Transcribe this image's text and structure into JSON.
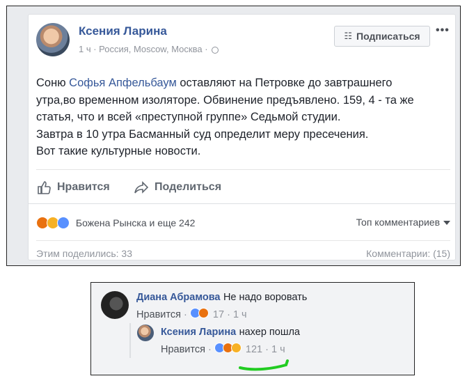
{
  "post": {
    "author": "Ксения Ларина",
    "meta": "1 ч · Россия, Moscow, Москва ·",
    "subscribe_label": "Подписаться",
    "more_label": "•••",
    "text_lines": [
      {
        "before": "Соню ",
        "mention": "Софья Апфельбаум",
        "after": " оставляют на Петровке до завтрашнего"
      },
      {
        "text": "утра,во временном изоляторе. Обвинение предъявлено. 159, 4 - та же"
      },
      {
        "text": "статья, что и всей «преступной группе» Седьмой студии."
      },
      {
        "text": "Завтра в 10 утра Басманный суд определит меру пресечения."
      },
      {
        "text": "Вот такие культурные новости."
      }
    ],
    "like_label": "Нравится",
    "share_label": "Поделиться",
    "reactions_text": "Божена Рынска и еще 242",
    "top_comments_label": "Топ комментариев",
    "shares_text": "Этим поделились: 33",
    "comments_count_text": "Комментарии: (15)"
  },
  "comments": [
    {
      "author": "Диана Абрамова",
      "text": "Не надо воровать",
      "like_label": "Нравится",
      "reaction_count": "17",
      "time": "1 ч"
    },
    {
      "author": "Ксения Ларина",
      "text": "нахер пошла",
      "like_label": "Нравится",
      "reaction_count": "121",
      "time": "1 ч"
    }
  ],
  "colors": {
    "link": "#365899",
    "highlight_stroke": "#22cc22",
    "like": "#5890ff",
    "angry": "#e9710f",
    "wow": "#f7b125"
  }
}
